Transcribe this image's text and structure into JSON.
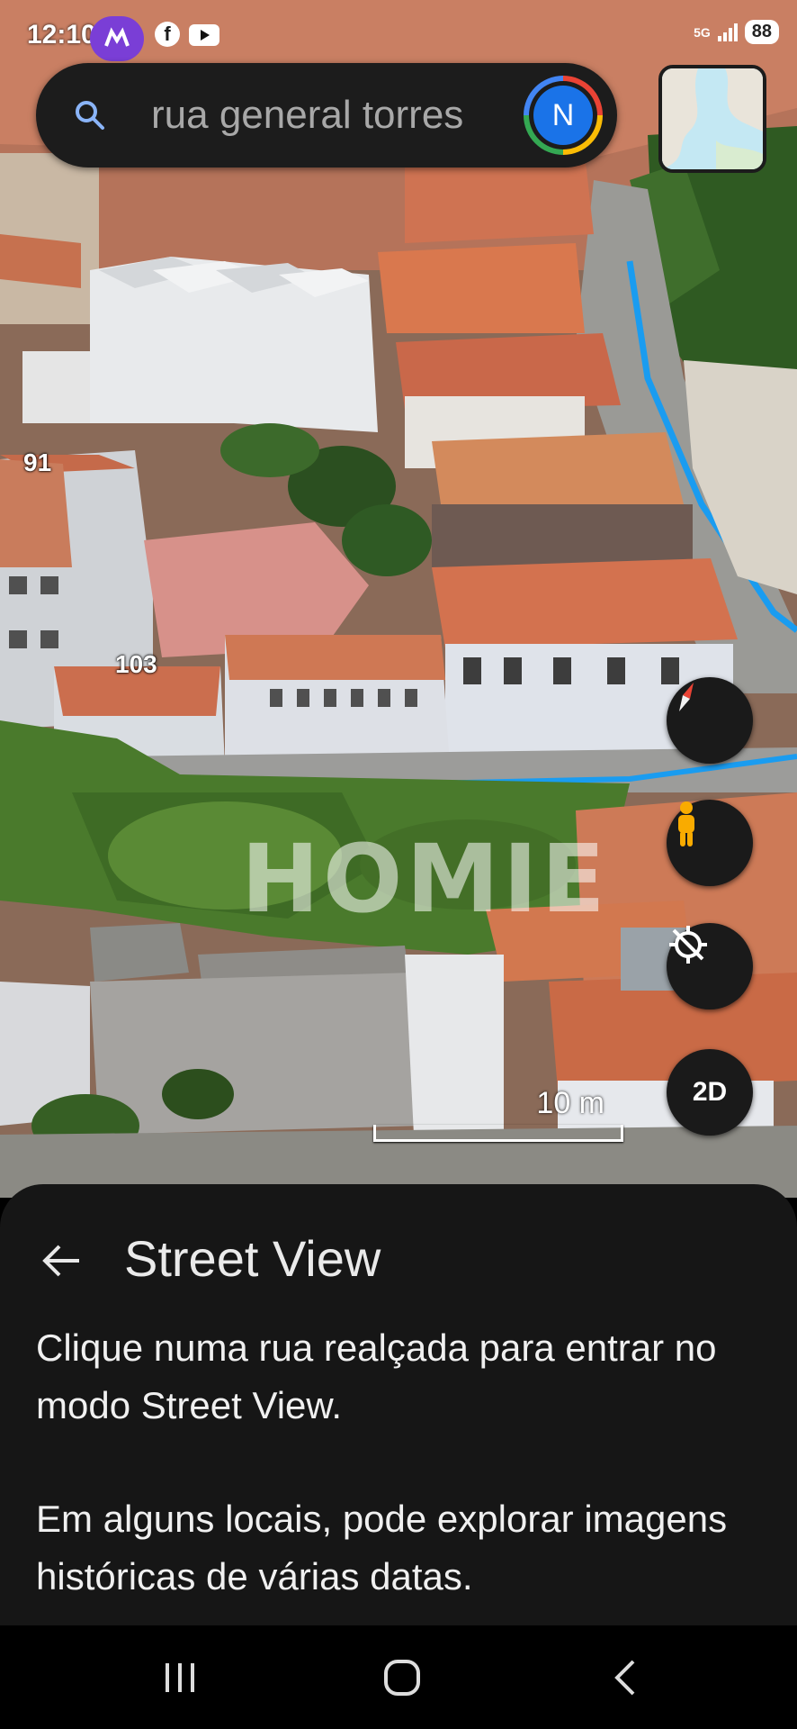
{
  "status_bar": {
    "time": "12:10",
    "network": "5G",
    "battery": "88",
    "app_icons": [
      "messenger-icon",
      "facebook-icon",
      "youtube-icon"
    ]
  },
  "search": {
    "value": "rua general torres",
    "avatar_letter": "N"
  },
  "map": {
    "labels": [
      "91",
      "103"
    ],
    "watermark": "HOMIE",
    "scale_label": "10 m"
  },
  "controls": {
    "compass": "compass-icon",
    "pegman": "pegman-icon",
    "location": "location-off-icon",
    "view_mode": "2D"
  },
  "sheet": {
    "title": "Street View",
    "p1": "Clique numa rua realçada para entrar no modo Street View.",
    "p2": "Em alguns locais, pode explorar imagens históricas de várias datas."
  },
  "colors": {
    "street_highlight": "#1a9cf0",
    "accent_blue": "#1a73e8",
    "pegman": "#f9ab00",
    "compass_red": "#ea4335"
  }
}
